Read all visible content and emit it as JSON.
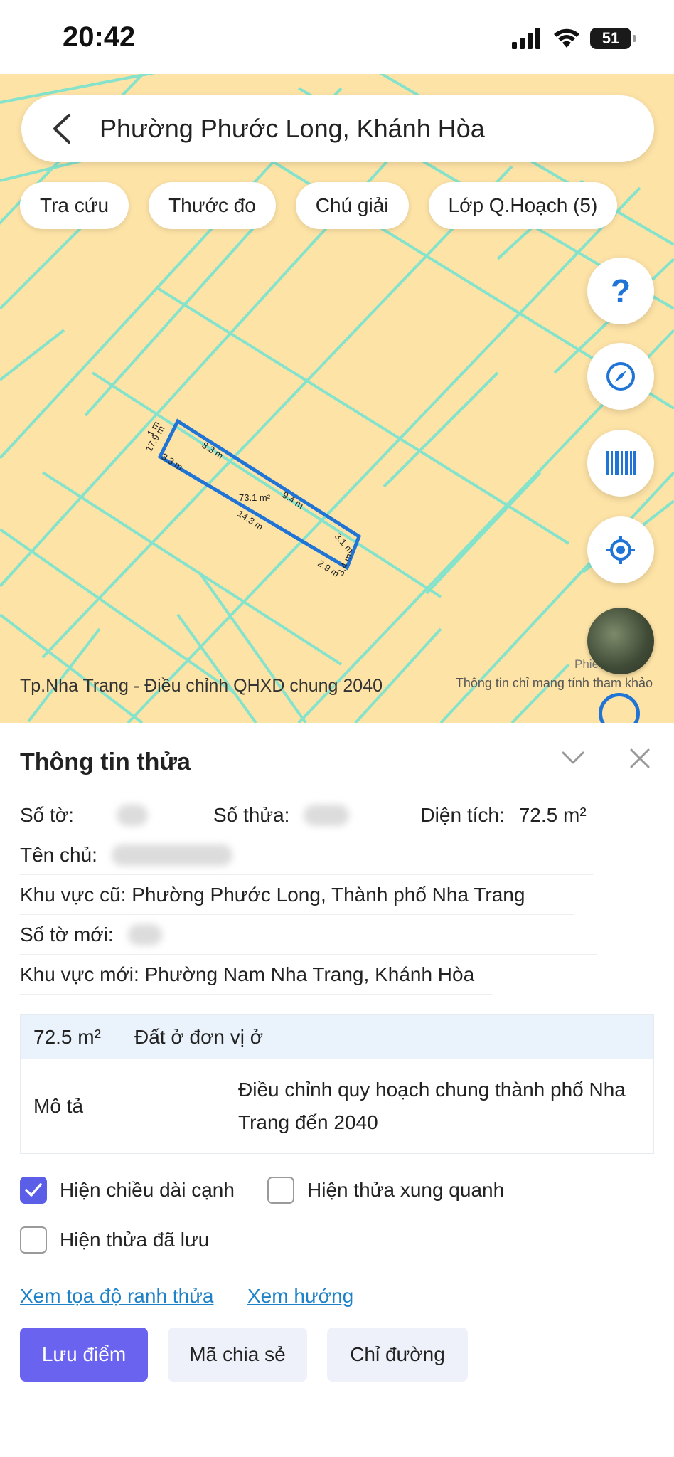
{
  "status": {
    "time": "20:42",
    "battery": "51"
  },
  "search": {
    "text": "Phường Phước Long, Khánh Hòa"
  },
  "chips": [
    "Tra cứu",
    "Thước đo",
    "Chú giải",
    "Lớp Q.Hoạch (5)"
  ],
  "map": {
    "caption": "Tp.Nha Trang - Điều chỉnh QHXD chung 2040",
    "note": "Thông tin chỉ mang tính tham khảo",
    "partial_label": "Phiê",
    "help_symbol": "?",
    "parcel_labels": {
      "area": "73.1 m²",
      "top1": "8.3 m",
      "top2": "9.4 m",
      "right1": "3.1 m",
      "right2": "3.4 m",
      "bottom1": "14.3 m",
      "bottom2": "2.9 m",
      "left1": "3.3 m",
      "left2": "17.9 m",
      "left3": "1 m"
    },
    "colors": {
      "land": "#fde3a6",
      "boundary": "#7fe3cf",
      "parcel": "#1f74d6"
    }
  },
  "panel": {
    "title": "Thông tin thửa",
    "so_to_label": "Số tờ:",
    "so_thua_label": "Số thửa:",
    "dien_tich_label": "Diện tích:",
    "dien_tich_value": "72.5 m²",
    "ten_chu_label": "Tên chủ:",
    "khu_vuc_cu": "Khu vực cũ: Phường Phước Long, Thành phố Nha Trang",
    "so_to_moi_label": "Số tờ mới:",
    "khu_vuc_moi": "Khu vực mới: Phường Nam Nha Trang, Khánh Hòa",
    "table": {
      "area": "72.5 m²",
      "land_type": "Đất ở đơn vị ở",
      "desc_label": "Mô tả",
      "desc_value": "Điều chỉnh quy hoạch chung thành phố Nha Trang đến 2040"
    },
    "checkboxes": {
      "show_edges": "Hiện chiều dài cạnh",
      "show_neighbors": "Hiện thửa xung quanh",
      "show_saved": "Hiện thửa đã lưu"
    },
    "links": {
      "coords": "Xem tọa độ ranh thửa",
      "direction": "Xem hướng"
    },
    "buttons": {
      "save": "Lưu điểm",
      "share": "Mã chia sẻ",
      "route": "Chỉ đường"
    },
    "accent": "#6a63f0"
  }
}
